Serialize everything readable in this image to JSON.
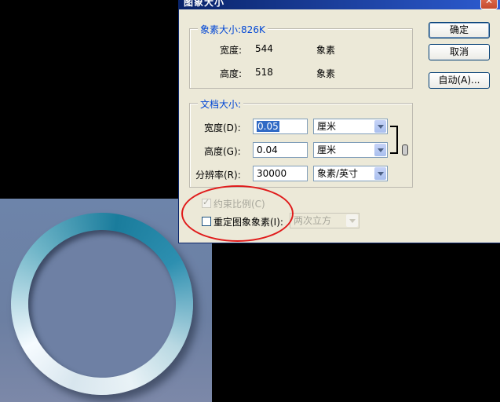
{
  "dialog": {
    "title": "图象大小",
    "close_glyph": "✕",
    "pixel_dimensions": {
      "label": "象素大小:826K",
      "width_label": "宽度:",
      "width_value": "544",
      "width_unit": "象素",
      "height_label": "高度:",
      "height_value": "518",
      "height_unit": "象素"
    },
    "document_size": {
      "label": "文档大小:",
      "width_label": "宽度(D):",
      "width_value": "0.05",
      "width_unit": "厘米",
      "height_label": "高度(G):",
      "height_value": "0.04",
      "height_unit": "厘米",
      "resolution_label": "分辨率(R):",
      "resolution_value": "30000",
      "resolution_unit": "象素/英寸"
    },
    "constrain_proportions_label": "约束比例(C)",
    "resample_label": "重定图象象素(I):",
    "resample_method": "两次立方",
    "buttons": {
      "ok": "确定",
      "cancel": "取消",
      "auto": "自动(A)..."
    }
  },
  "colors": {
    "title_bar": "#0a246a",
    "group_label": "#0046d5",
    "highlight": "#e01b1b",
    "canvas_bg": "#6d84aa",
    "ring_accent": "#1a7c9c"
  }
}
